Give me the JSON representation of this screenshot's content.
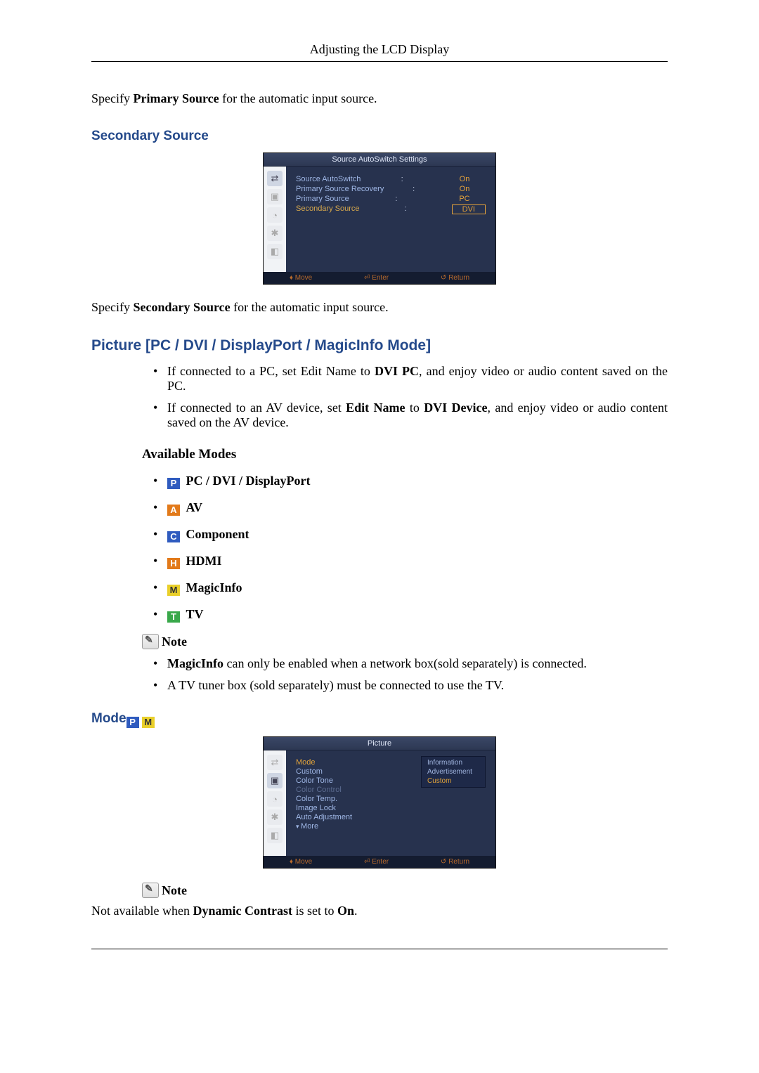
{
  "pageHeader": "Adjusting the LCD Display",
  "intro1_a": "Specify ",
  "intro1_b": "Primary Source",
  "intro1_c": " for the automatic input source.",
  "secondarySourceHeading": "Secondary Source",
  "osd1": {
    "title": "Source AutoSwitch Settings",
    "rows": {
      "r1l": "Source AutoSwitch",
      "r1v": "On",
      "r2l": "Primary Source Recovery",
      "r2v": "On",
      "r3l": "Primary Source",
      "r3v": "PC",
      "r4l": "Secondary Source",
      "r4v": "DVI"
    },
    "footer": {
      "move": "Move",
      "enter": "Enter",
      "ret": "Return"
    }
  },
  "secondary_a": "Specify ",
  "secondary_b": "Secondary Source",
  "secondary_c": " for the automatic input source.",
  "pictureHeading": "Picture [PC / DVI / DisplayPort / MagicInfo Mode]",
  "bullets1": {
    "b1a": "If connected to a PC, set Edit Name to ",
    "b1b": "DVI PC",
    "b1c": ", and enjoy video or audio content saved on the PC.",
    "b2a": "If connected to an AV device, set ",
    "b2b": "Edit Name",
    "b2c": " to ",
    "b2d": "DVI Device",
    "b2e": ", and enjoy video or audio content saved on the AV device."
  },
  "availModes": "Available Modes",
  "modes": {
    "p": "PC / DVI / DisplayPort",
    "a": "AV",
    "c": "Component",
    "h": "HDMI",
    "m": "MagicInfo",
    "t": "TV"
  },
  "noteLabel": "Note",
  "noteBullets": {
    "n1a": "MagicInfo",
    "n1b": " can only be enabled when a network box(sold separately) is connected.",
    "n2": "A TV tuner box (sold separately) must be connected to use the TV."
  },
  "modeHeading": "Mode",
  "osd2": {
    "title": "Picture",
    "left": {
      "l1": "Mode",
      "l2": "Custom",
      "l3": "Color Tone",
      "l4": "Color Control",
      "l5": "Color Temp.",
      "l6": "Image Lock",
      "l7": "Auto Adjustment",
      "l8": "More"
    },
    "sub": {
      "s1": "Information",
      "s2": "Advertisement",
      "s3": "Custom"
    },
    "footer": {
      "move": "Move",
      "enter": "Enter",
      "ret": "Return"
    }
  },
  "note2_a": "Not available when ",
  "note2_b": "Dynamic Contrast",
  "note2_c": " is set to ",
  "note2_d": "On",
  "note2_e": "."
}
